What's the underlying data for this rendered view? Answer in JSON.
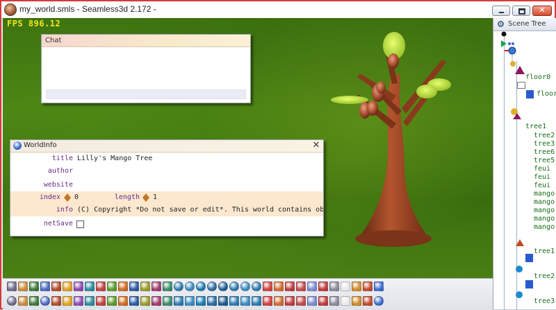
{
  "window": {
    "title": "my_world.smls - Seamless3d 2.172 -",
    "controls": [
      "minimize-button",
      "maximize-button",
      "close-button"
    ]
  },
  "viewport": {
    "fps_text": "FPS  896.12"
  },
  "chat": {
    "title": "Chat",
    "input_value": ""
  },
  "world_info": {
    "title": "WorldInfo",
    "close_glyph": "✕",
    "fields": {
      "title": {
        "label": "title",
        "value": "Lilly's Mango Tree"
      },
      "author": {
        "label": "author",
        "value": ""
      },
      "website": {
        "label": "website",
        "value": ""
      },
      "index": {
        "label": "index",
        "value": "0"
      },
      "length": {
        "label": "length",
        "value": "1"
      },
      "info": {
        "label": "info",
        "value": "(C) Copyright *Do not save or edit*. This world contains ob"
      },
      "netSave": {
        "label": "netSave",
        "checked": false
      }
    }
  },
  "scene_tree": {
    "tab_label": "Scene Tree",
    "nodes": [
      "floor0",
      "floor",
      "tree1",
      "tree2",
      "tree3",
      "tree6",
      "tree5",
      "feui",
      "feui",
      "feui",
      "mango",
      "mango",
      "mango",
      "mango",
      "mango",
      "tree1",
      "tree2",
      "tree3"
    ]
  },
  "toolbar": {
    "row1_icons": [
      "new-icon",
      "open-icon",
      "save-icon",
      "print-icon",
      "tree-icon",
      "copy-icon",
      "paste-icon",
      "undo-icon",
      "redo-icon",
      "shape-icon",
      "grid-icon",
      "material-icon",
      "cube-icon",
      "box-icon",
      "link-icon",
      "sphere-icon",
      "sphere-icon",
      "sphere-icon",
      "sphere-icon",
      "sphere-icon",
      "sphere-icon",
      "sphere-icon",
      "sphere-icon",
      "record-icon",
      "move-icon",
      "rotate-icon",
      "scale-icon",
      "pause-icon",
      "target-icon",
      "target-icon",
      "face-icon",
      "up-icon",
      "bars-icon",
      "help-icon"
    ],
    "row2_icons": [
      "ball-icon",
      "texture-icon",
      "cone-icon",
      "sphere-icon",
      "face-icon",
      "cube-icon",
      "cube-icon",
      "grid-icon",
      "cylinder-icon",
      "paint-icon",
      "triangle-icon",
      "frame-icon",
      "square-icon",
      "tool-icon",
      "figure-icon",
      "face-icon",
      "flag-icon",
      "image-icon",
      "picture-icon",
      "image-icon",
      "triangle-icon",
      "mountain-icon",
      "vertex-icon",
      "move-icon",
      "arrow-icon",
      "down-icon",
      "down-icon",
      "pointer-icon",
      "zoom-icon",
      "image-icon",
      "image-icon",
      "grid-icon",
      "grid-icon",
      "globe-icon"
    ],
    "colors": [
      "#6c6c8a",
      "#c98a3a",
      "#3a7a3a",
      "#4a6ac0",
      "#b04a2a",
      "#e0a020",
      "#8a4ab0",
      "#2a8a9a",
      "#c04040",
      "#5a9a2a",
      "#d06a20",
      "#2a5aa0",
      "#9a9a2a",
      "#a03a6a",
      "#3a8a6a",
      "#2a7ab0",
      "#3a8ac0",
      "#1a7ab0",
      "#2a6aa0",
      "#1a5a90",
      "#2a7ab0",
      "#3a8ac0",
      "#2a7ab0",
      "#d04040",
      "#d06a30",
      "#c03a3a",
      "#c04a4a",
      "#7a8ad0",
      "#c03a3a",
      "#8a8a9a",
      "#e8e8e8",
      "#d08a2a",
      "#c04a2a",
      "#3a6ad0"
    ]
  }
}
